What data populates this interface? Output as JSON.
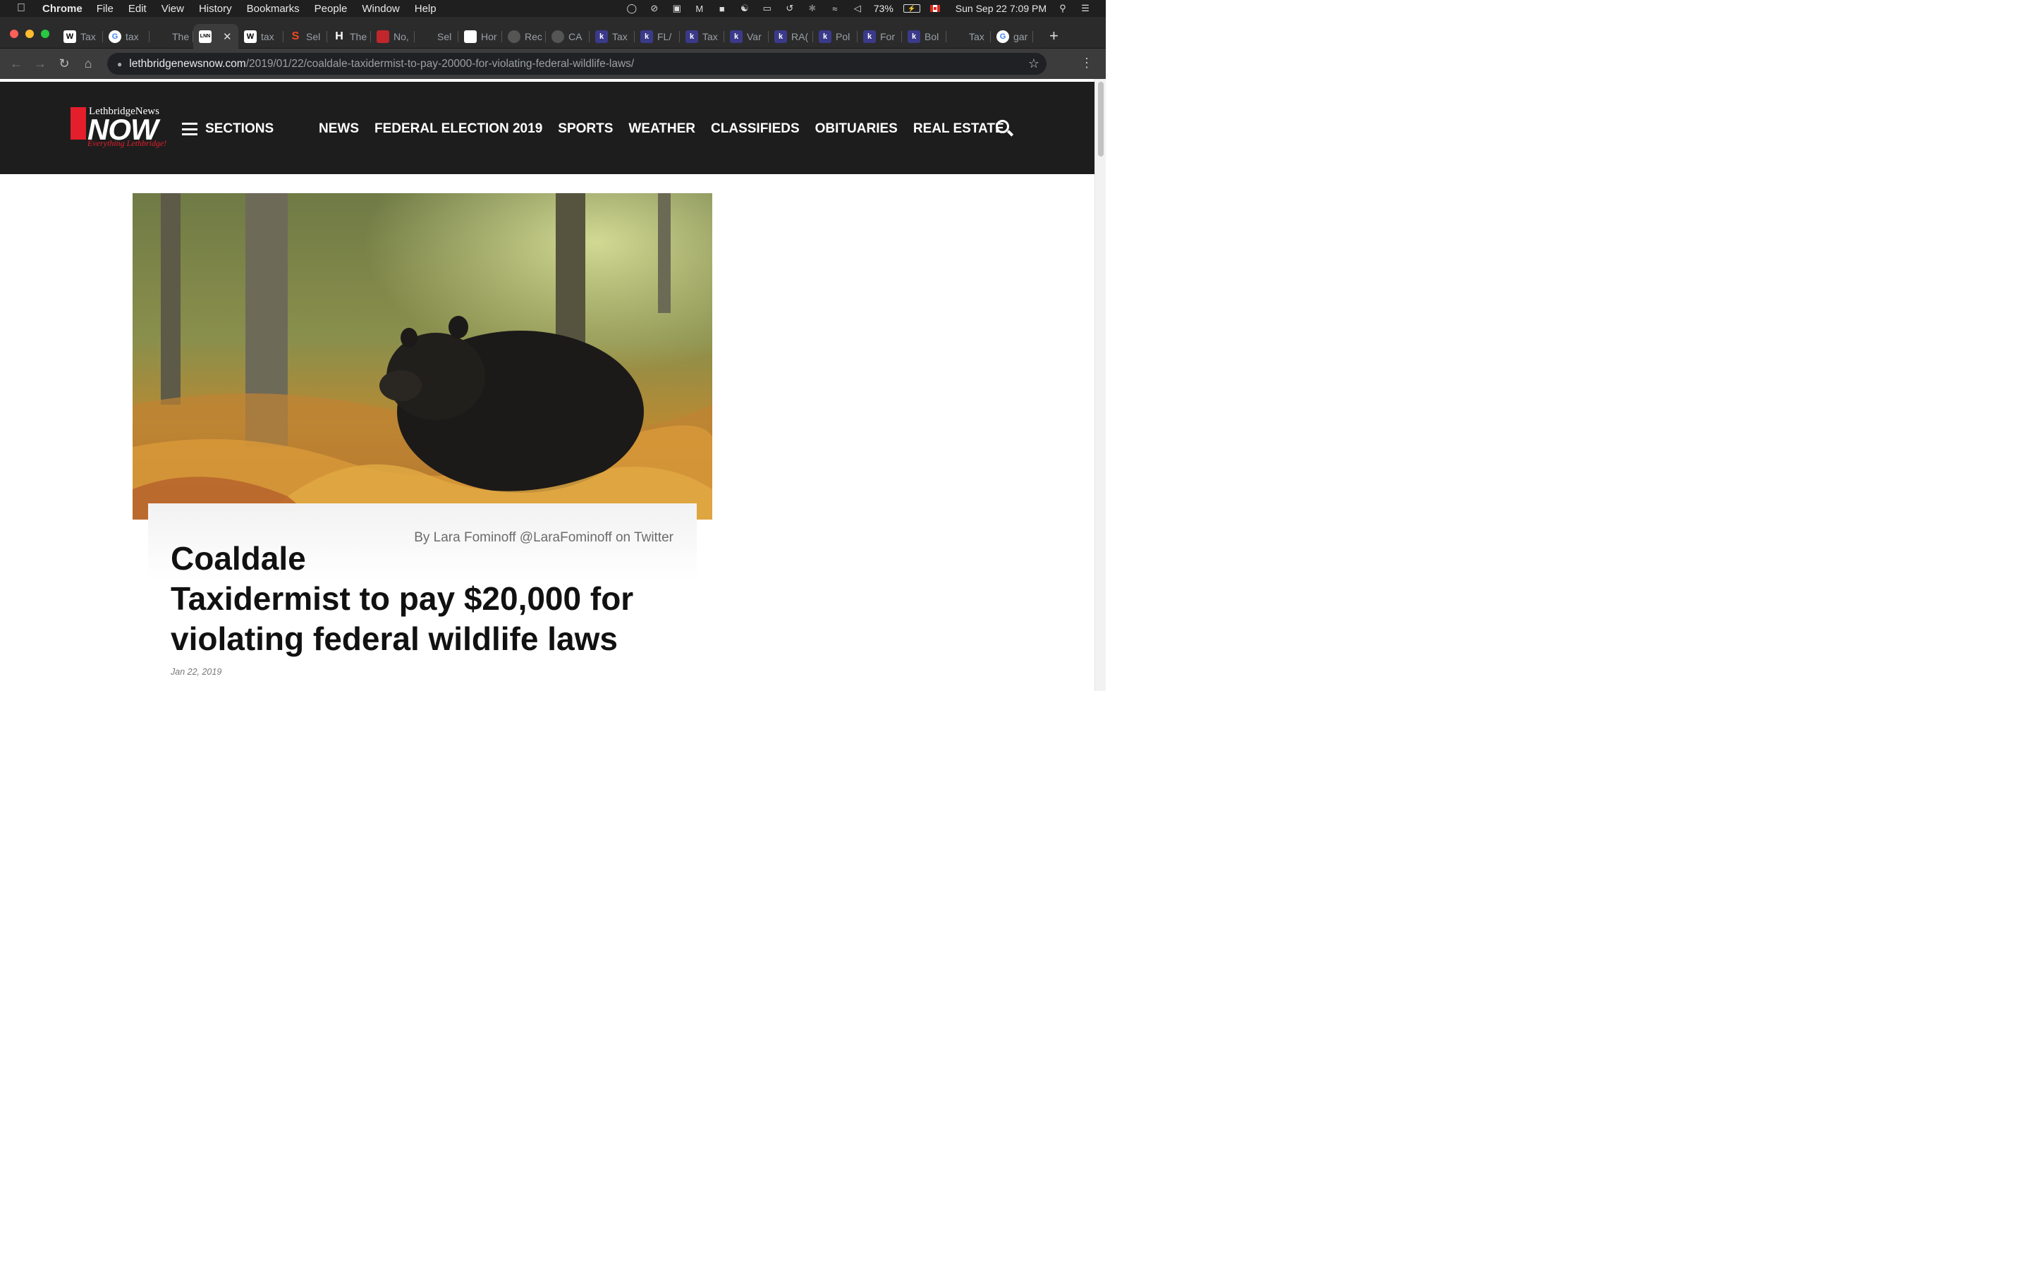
{
  "menubar": {
    "app": "Chrome",
    "items": [
      "File",
      "Edit",
      "View",
      "History",
      "Bookmarks",
      "People",
      "Window",
      "Help"
    ],
    "battery": "73%",
    "datetime": "Sun Sep 22  7:09 PM"
  },
  "tabs": [
    {
      "favicon": "W",
      "title": "Tax"
    },
    {
      "favicon": "G",
      "title": "tax"
    },
    {
      "favicon": "",
      "title": "The"
    },
    {
      "favicon": "LNN",
      "title": "",
      "active": true
    },
    {
      "favicon": "W",
      "title": "tax"
    },
    {
      "favicon": "S",
      "title": "Sel"
    },
    {
      "favicon": "H",
      "title": "The"
    },
    {
      "favicon": "",
      "title": "No,"
    },
    {
      "favicon": "",
      "title": "Sel"
    },
    {
      "favicon": "",
      "title": "Hor"
    },
    {
      "favicon": "",
      "title": "Rec"
    },
    {
      "favicon": "",
      "title": "CA"
    },
    {
      "favicon": "k",
      "title": "Tax"
    },
    {
      "favicon": "k",
      "title": "FL/"
    },
    {
      "favicon": "k",
      "title": "Tax"
    },
    {
      "favicon": "k",
      "title": "Var"
    },
    {
      "favicon": "k",
      "title": "RA("
    },
    {
      "favicon": "k",
      "title": "Pol"
    },
    {
      "favicon": "k",
      "title": "For"
    },
    {
      "favicon": "k",
      "title": "Bol"
    },
    {
      "favicon": "",
      "title": "Tax"
    },
    {
      "favicon": "G",
      "title": "gar"
    }
  ],
  "omnibox": {
    "host": "lethbridgenewsnow.com",
    "path": "/2019/01/22/coaldale-taxidermist-to-pay-20000-for-violating-federal-wildlife-laws/"
  },
  "site": {
    "logo_top": "LethbridgeNews",
    "logo_main": "NOW",
    "logo_tagline": "Everything Lethbridge!",
    "sections_label": "SECTIONS",
    "nav": [
      "NEWS",
      "FEDERAL ELECTION 2019",
      "SPORTS",
      "WEATHER",
      "CLASSIFIEDS",
      "OBITUARIES",
      "REAL ESTATE"
    ]
  },
  "article": {
    "byline": "By Lara Fominoff @LaraFominoff on Twitter",
    "headline_line1": "Coaldale",
    "headline_line2": "Taxidermist to pay $20,000 for violating federal wildlife laws",
    "date": "Jan 22, 2019"
  },
  "colors": {
    "brand_red": "#e41e2b",
    "header_bg": "#1d1d1d"
  }
}
